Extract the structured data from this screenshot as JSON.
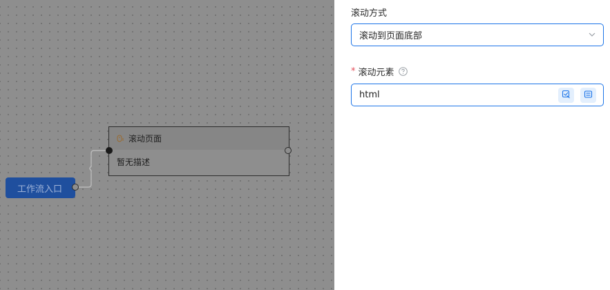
{
  "canvas": {
    "entry_node_label": "工作流入口",
    "node": {
      "title": "滚动页面",
      "description": "暂无描述"
    }
  },
  "panel": {
    "scroll_mode": {
      "label": "滚动方式",
      "value": "滚动到页面底部"
    },
    "scroll_element": {
      "required_mark": "*",
      "label": "滚动元素",
      "value": "html"
    }
  },
  "colors": {
    "accent": "#1a73e8",
    "entry_node": "#1f4f9e",
    "required": "#e34d59"
  }
}
